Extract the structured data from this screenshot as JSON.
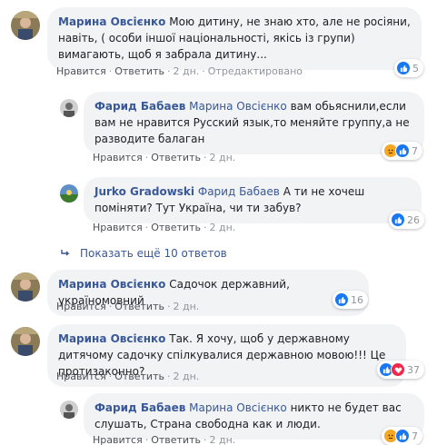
{
  "comments": [
    {
      "author": "Марина Овсієнко",
      "text": "Мою дитину, не знаю хто, але не росіяни, навіть, ( особи іншої національності, якісь із групи) вимагають, щоб я забрала дитину...",
      "like": "Нравится",
      "reply": "Ответить",
      "time": "2 дн.",
      "edited": "Отредактировано",
      "reactions": {
        "types": [
          "like"
        ],
        "count": "5"
      }
    },
    {
      "author": "Фарид Бабаев",
      "mention": "Марина Овсієнко",
      "text": " вам обьяснили,если вам не нравится Русский язык,то меняйте группу,а не разводите балаган",
      "like": "Нравится",
      "reply": "Ответить",
      "time": "2 дн.",
      "reactions": {
        "types": [
          "angry",
          "like"
        ],
        "count": "7"
      }
    },
    {
      "author": "Jurko Gradowski",
      "mention": "Фарид Бабаев",
      "text": " А ти не хочеш поміняти? Тут Україна, чи ти забув?",
      "like": "Нравится",
      "reply": "Ответить",
      "time": "2 дн.",
      "reactions": {
        "types": [
          "like"
        ],
        "count": "26"
      }
    },
    {
      "author": "Марина Овсієнко",
      "text": "Садочок державний, україномовний",
      "like": "Нравится",
      "reply": "Ответить",
      "time": "2 дн.",
      "reactions": {
        "types": [
          "like"
        ],
        "count": "16"
      }
    },
    {
      "author": "Марина Овсієнко",
      "text": "Так. Я хочу, щоб у державному дитячому садочку спілкувалися державною мовою!!! Це протизаконно?",
      "like": "Нравится",
      "reply": "Ответить",
      "time": "2 дн.",
      "reactions": {
        "types": [
          "like",
          "love"
        ],
        "count": "37"
      }
    },
    {
      "author": "Фарид Бабаев",
      "mention": "Марина Овсієнко",
      "text": " никто не будет вас слушать, Страна свободна как и люди.",
      "like": "Нравится",
      "reply": "Ответить",
      "time": "2 дн.",
      "reactions": {
        "types": [
          "angry",
          "like"
        ],
        "count": "7"
      }
    }
  ],
  "more_replies": "Показать ещё 10 ответов",
  "colors": {
    "link": "#385898",
    "bubble": "#f2f3f5",
    "like": "#1877f2"
  }
}
